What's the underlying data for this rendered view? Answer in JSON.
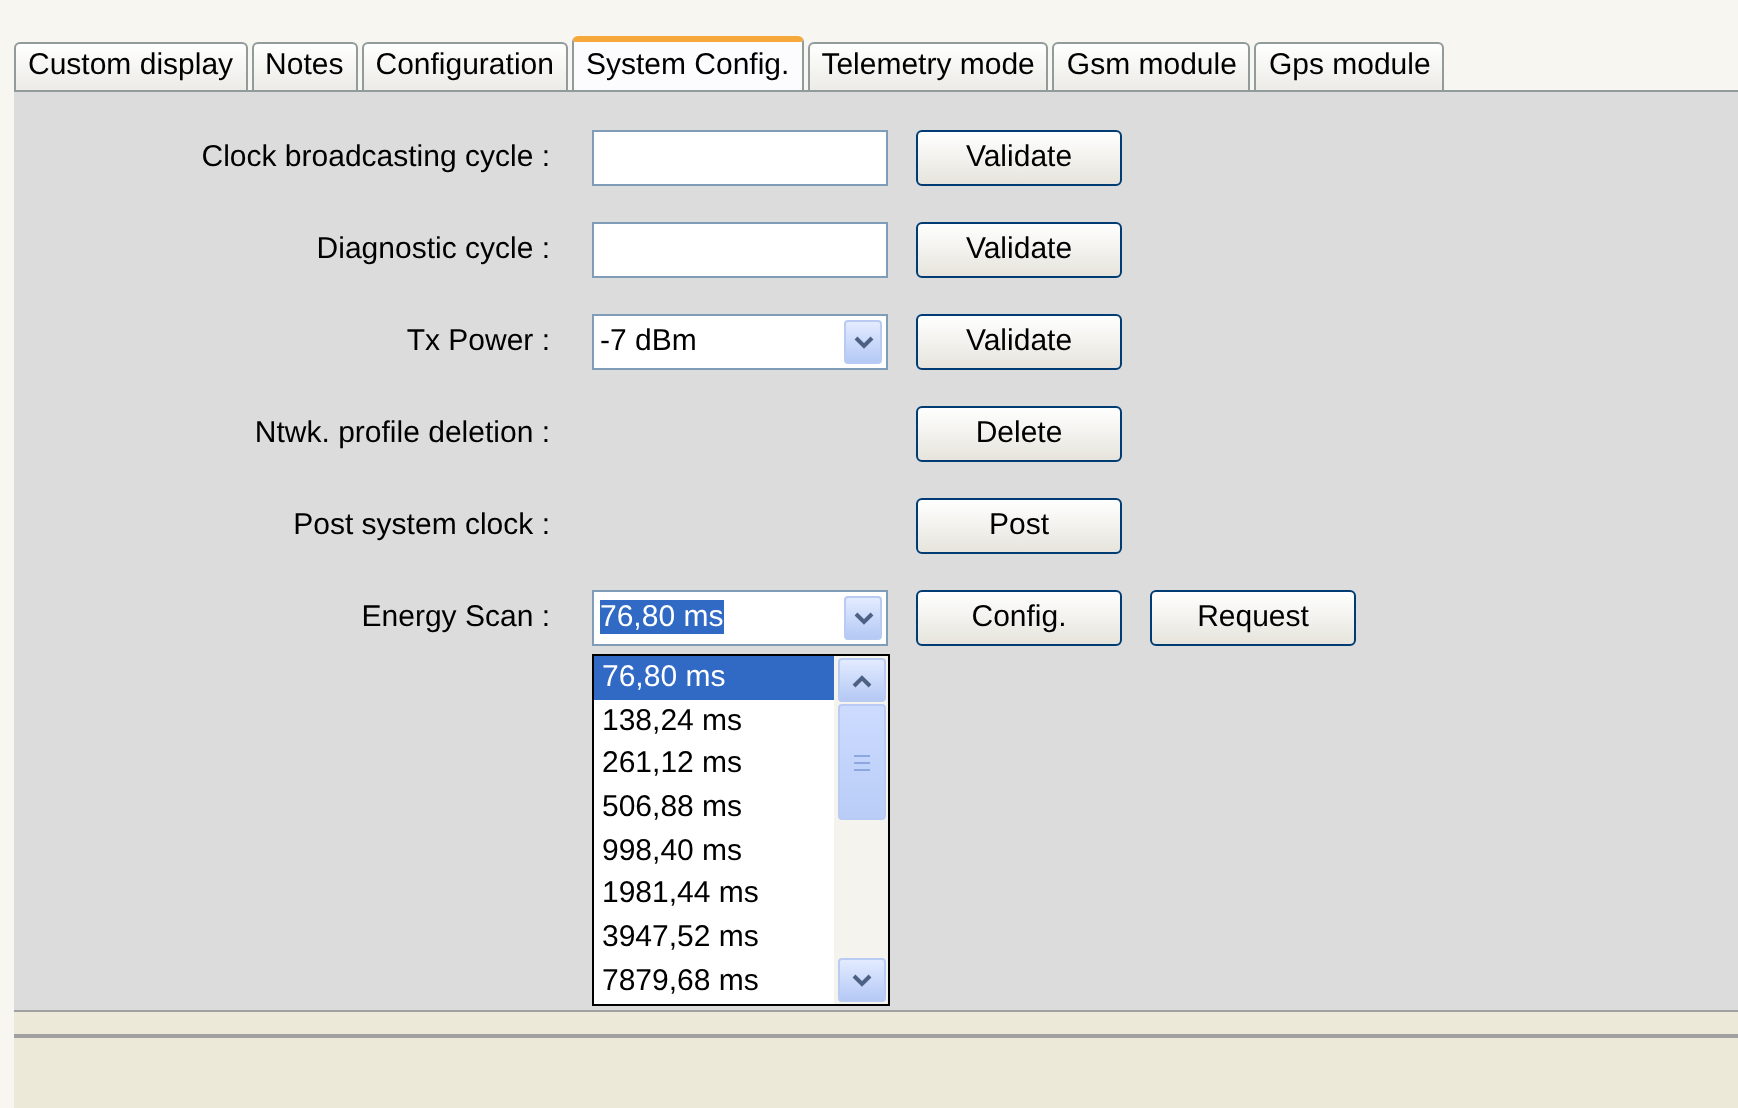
{
  "tabs": [
    {
      "label": "Custom display",
      "selected": false
    },
    {
      "label": "Notes",
      "selected": false
    },
    {
      "label": "Configuration",
      "selected": false
    },
    {
      "label": "System Config.",
      "selected": true
    },
    {
      "label": "Telemetry mode",
      "selected": false
    },
    {
      "label": "Gsm module",
      "selected": false
    },
    {
      "label": "Gps module",
      "selected": false
    }
  ],
  "rows": [
    {
      "label": "Clock broadcasting cycle :",
      "kind": "text",
      "buttons": [
        "Validate"
      ]
    },
    {
      "label": "Diagnostic cycle :",
      "kind": "text",
      "buttons": [
        "Validate"
      ]
    },
    {
      "label": "Tx Power :",
      "kind": "select",
      "value": "-7 dBm",
      "buttons": [
        "Validate"
      ]
    },
    {
      "label": "Ntwk. profile deletion :",
      "kind": "none",
      "buttons": [
        "Delete"
      ]
    },
    {
      "label": "Post system clock :",
      "kind": "none",
      "buttons": [
        "Post"
      ]
    },
    {
      "label": "Energy Scan :",
      "kind": "select",
      "value": "76,80 ms",
      "expanded": true,
      "buttons": [
        "Config.",
        "Request"
      ],
      "options": [
        {
          "label": "76,80 ms",
          "selected": true
        },
        {
          "label": "138,24 ms",
          "selected": false
        },
        {
          "label": "261,12 ms",
          "selected": false
        },
        {
          "label": "506,88 ms",
          "selected": false
        },
        {
          "label": "998,40 ms",
          "selected": false
        },
        {
          "label": "1981,44 ms",
          "selected": false
        },
        {
          "label": "3947,52 ms",
          "selected": false
        },
        {
          "label": "7879,68 ms",
          "selected": false
        }
      ]
    }
  ]
}
